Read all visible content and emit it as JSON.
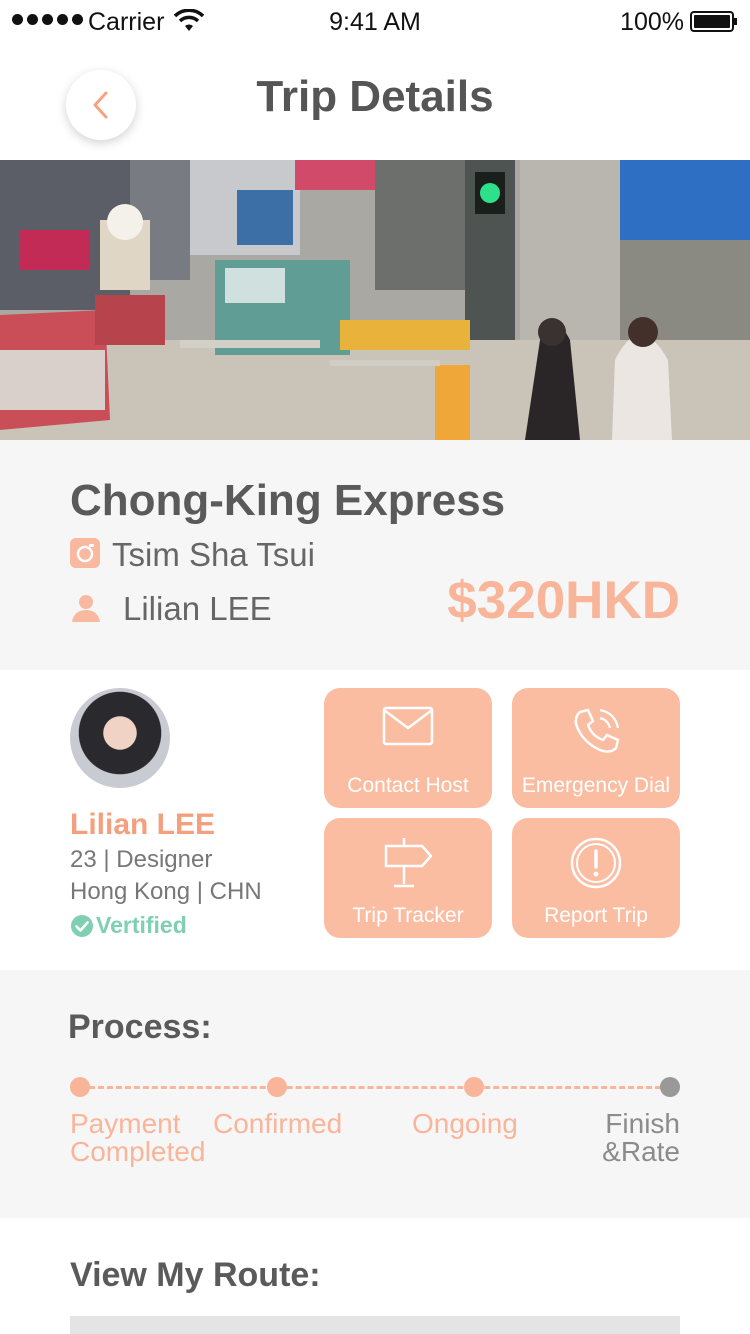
{
  "status_bar": {
    "carrier": "Carrier",
    "time": "9:41 AM",
    "battery": "100%"
  },
  "header": {
    "title": "Trip Details",
    "back_icon": "chevron-left-icon"
  },
  "trip": {
    "name": "Chong-King Express",
    "location": "Tsim Sha Tsui",
    "host": "Lilian LEE",
    "price": "$320HKD"
  },
  "host_card": {
    "name": "Lilian LEE",
    "meta_line1": "23 | Designer",
    "meta_line2": "Hong Kong | CHN",
    "verified": "Vertified"
  },
  "actions": [
    {
      "label": "Contact Host",
      "icon": "mail-icon"
    },
    {
      "label": "Emergency Dial",
      "icon": "phone-icon"
    },
    {
      "label": "Trip Tracker",
      "icon": "signpost-icon"
    },
    {
      "label": "Report Trip",
      "icon": "alert-icon"
    }
  ],
  "process": {
    "title": "Process:",
    "steps": [
      {
        "label_line1": "Payment",
        "label_line2": "Completed"
      },
      {
        "label_line1": "Confirmed",
        "label_line2": ""
      },
      {
        "label_line1": "Ongoing",
        "label_line2": ""
      },
      {
        "label_line1": "Finish",
        "label_line2": "&Rate"
      }
    ]
  },
  "route": {
    "title": "View My Route:"
  },
  "colors": {
    "accent": "#f9b59a",
    "accent_dark": "#f4a07f",
    "verified": "#7fcfb1",
    "section_bg": "#f6f6f6"
  }
}
